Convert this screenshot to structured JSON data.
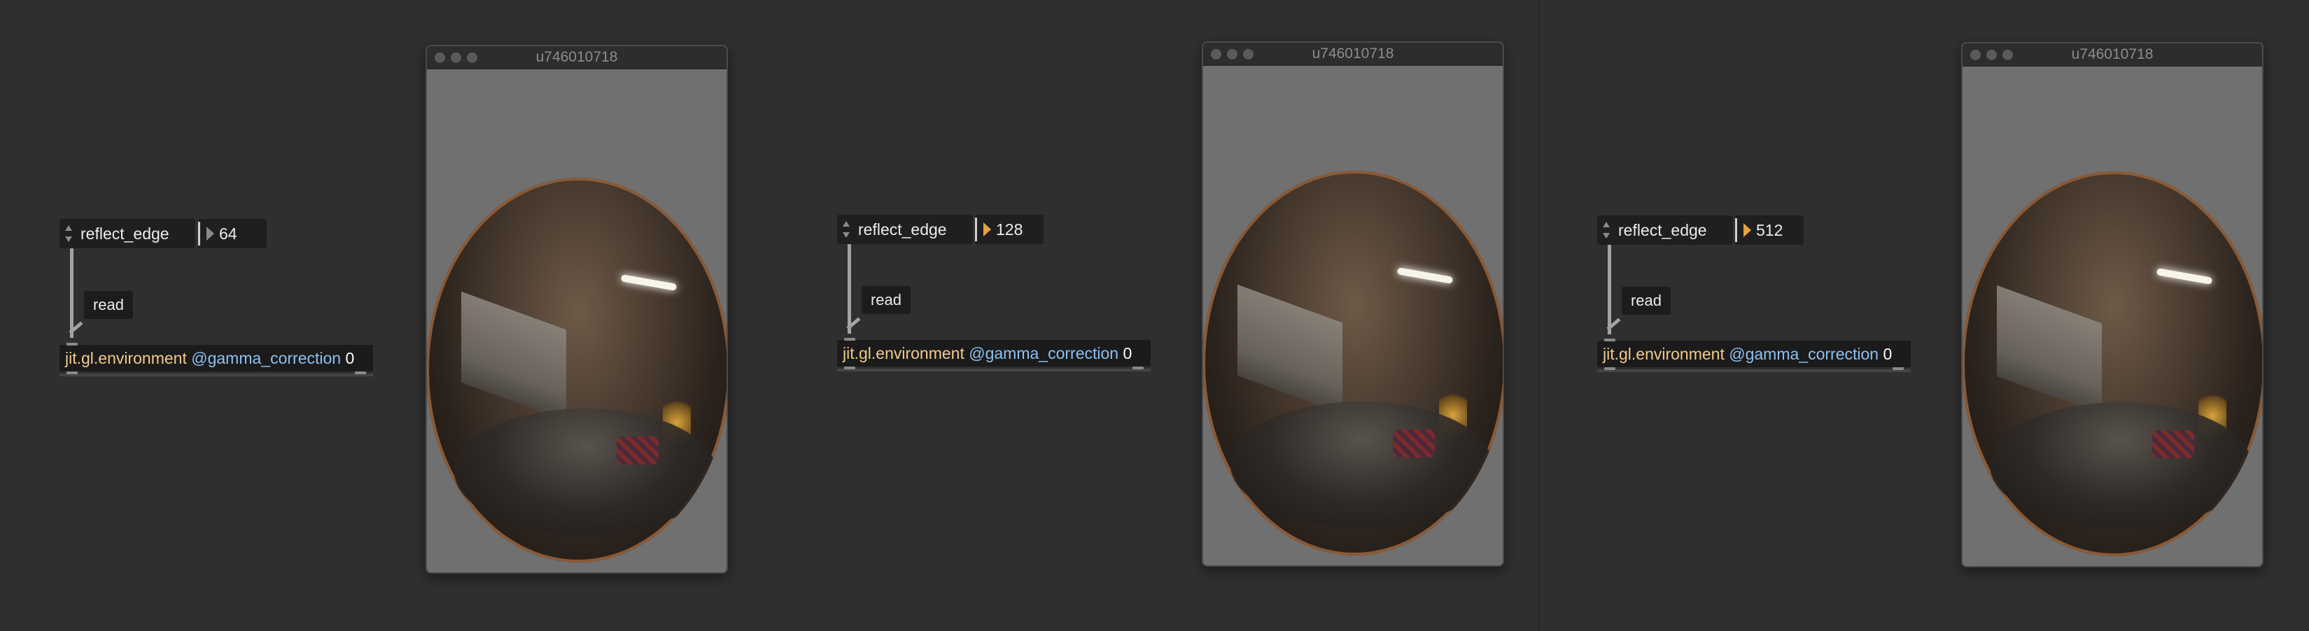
{
  "groups": [
    {
      "umenu_label": "reflect_edge",
      "number_value": "64",
      "message_label": "read",
      "object": {
        "class_name": "jit.gl.environment",
        "attribute": "@gamma_correction",
        "value": "0"
      },
      "window_title": "u746010718"
    },
    {
      "umenu_label": "reflect_edge",
      "number_value": "128",
      "message_label": "read",
      "object": {
        "class_name": "jit.gl.environment",
        "attribute": "@gamma_correction",
        "value": "0"
      },
      "window_title": "u746010718"
    },
    {
      "umenu_label": "reflect_edge",
      "number_value": "512",
      "message_label": "read",
      "object": {
        "class_name": "jit.gl.environment",
        "attribute": "@gamma_correction",
        "value": "0"
      },
      "window_title": "u746010718"
    }
  ],
  "colors": {
    "background": "#2f2f2f",
    "object_class": "#f2c98a",
    "object_attribute": "#8cc0f2",
    "number_triangle_active": "#e8a23c"
  }
}
